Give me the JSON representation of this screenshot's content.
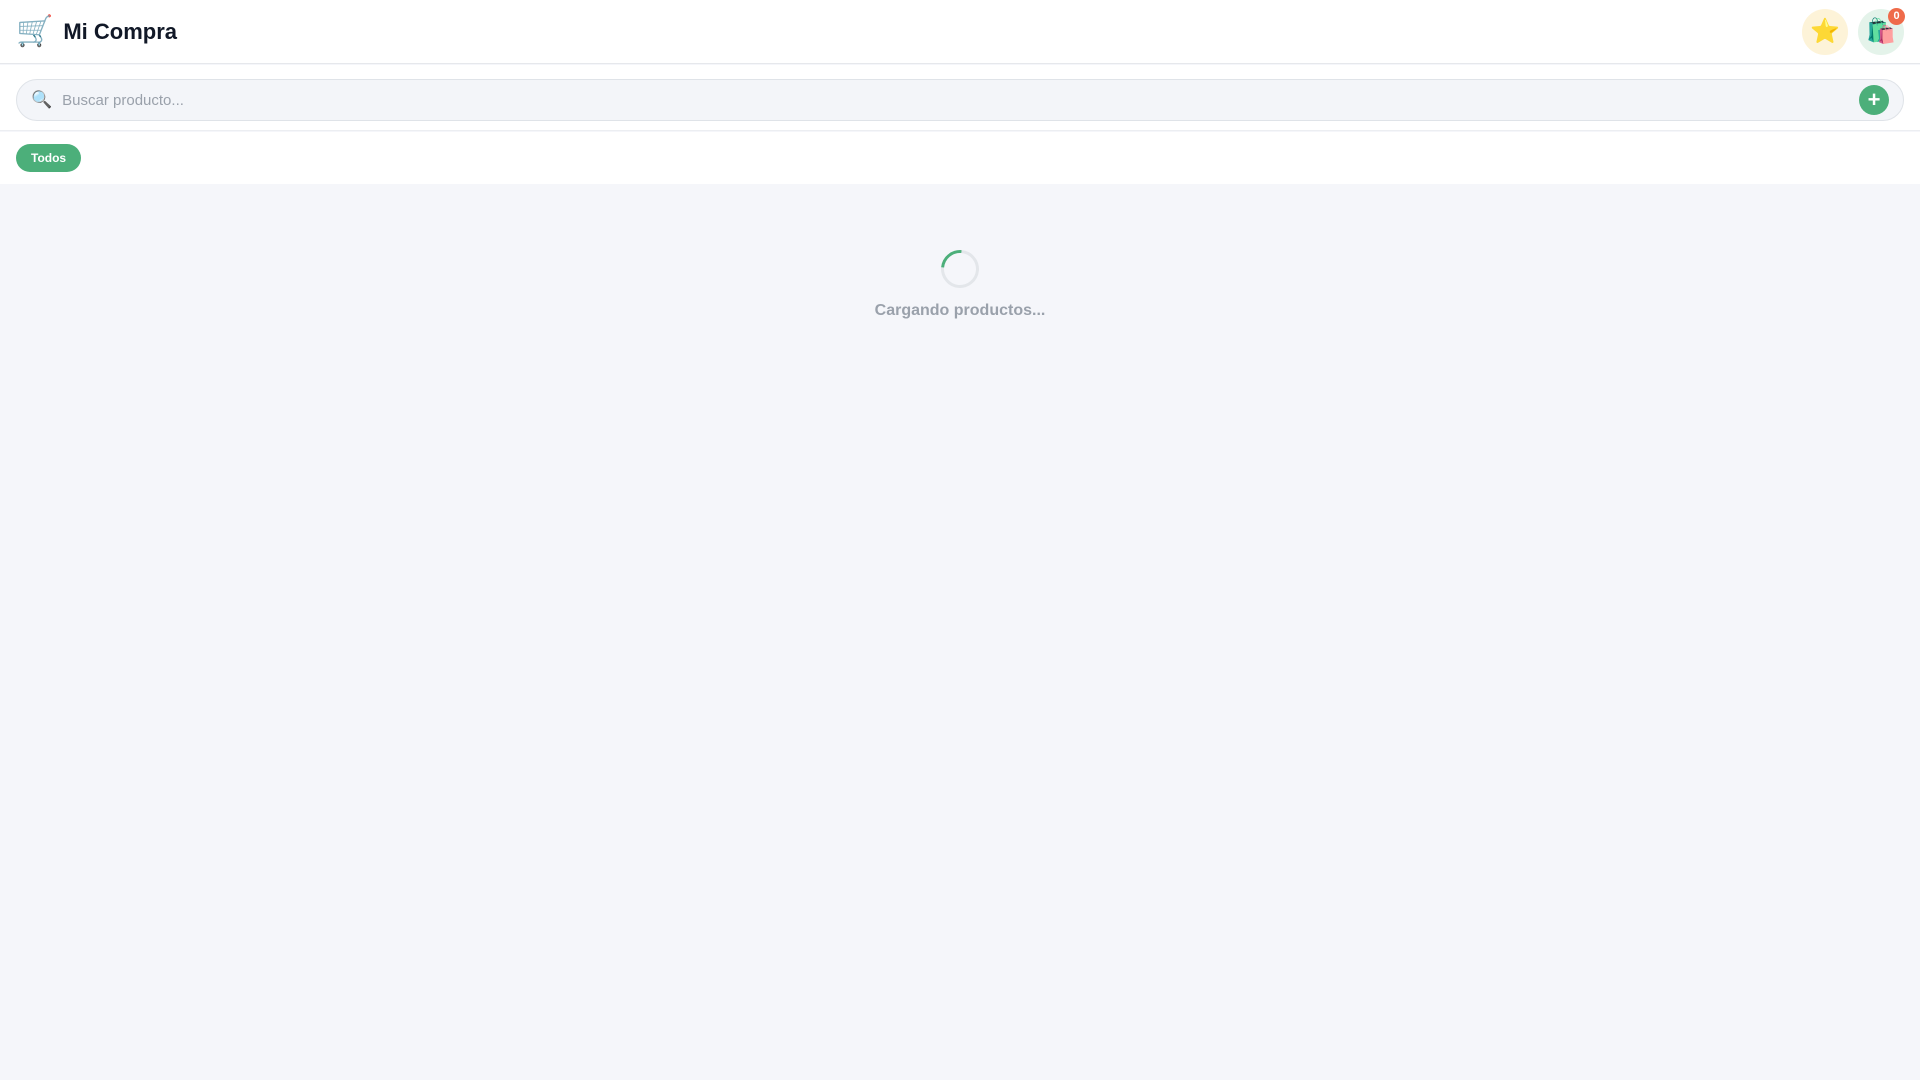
{
  "header": {
    "brand_icon": "shopping-cart-icon",
    "title": "Mi Compra",
    "favorites_icon": "star-icon",
    "cart_icon": "shopping-bags-icon",
    "cart_count": "0"
  },
  "search": {
    "icon": "search-icon",
    "placeholder": "Buscar producto...",
    "value": "",
    "add_label": "+"
  },
  "filters": {
    "chips": [
      {
        "label": "Todos",
        "active": true
      }
    ]
  },
  "main": {
    "loading_text": "Cargando productos..."
  },
  "colors": {
    "accent": "#4caf7a",
    "badge": "#ef6b4a",
    "background": "#f5f6fa"
  }
}
